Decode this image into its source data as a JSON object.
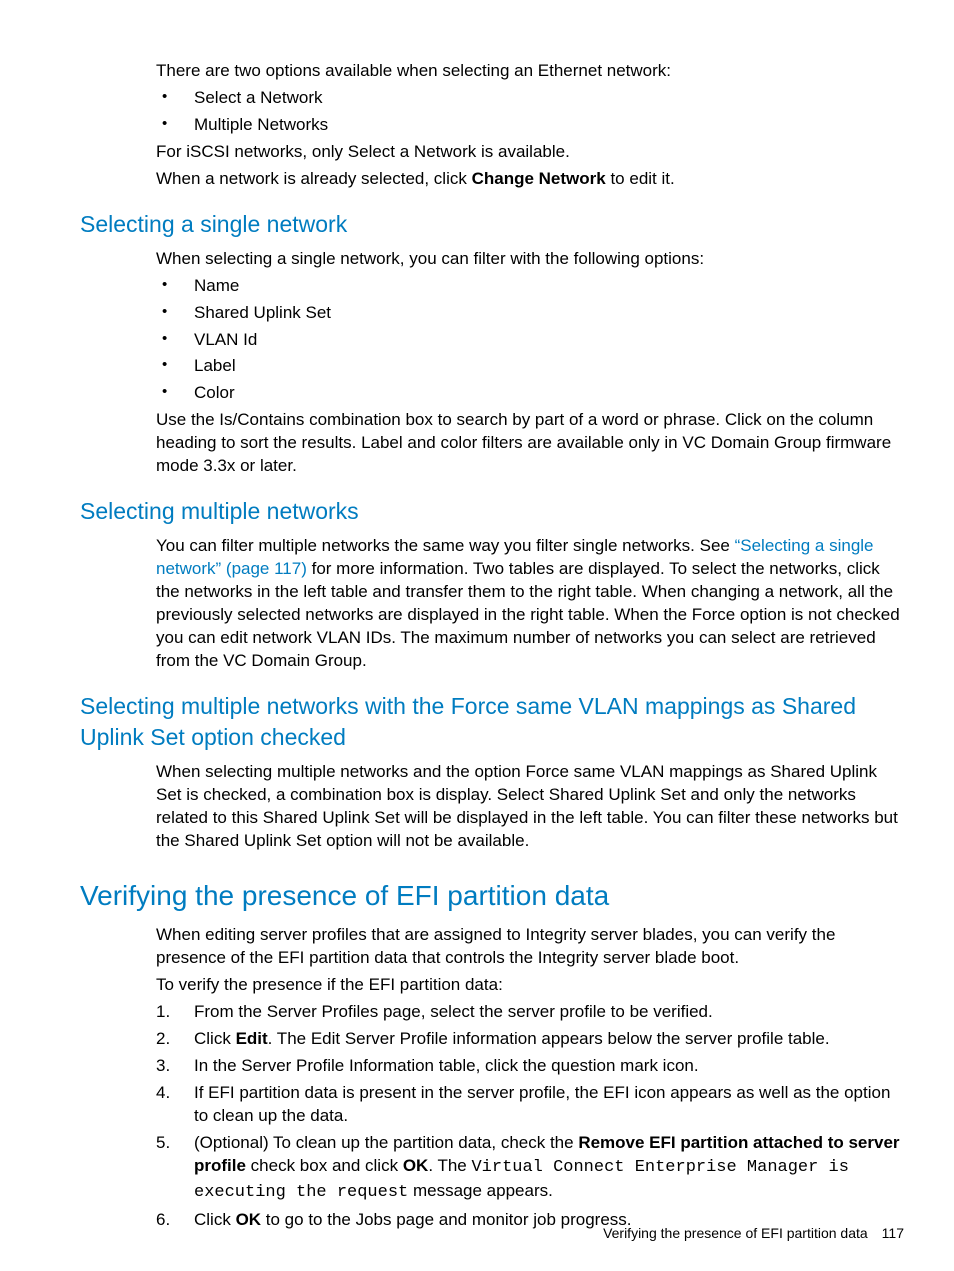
{
  "intro": {
    "line1": "There are two options available when selecting an Ethernet network:",
    "opts": [
      "Select a Network",
      "Multiple Networks"
    ],
    "line2": "For iSCSI networks, only Select a Network is available.",
    "line3_pre": "When a network is already selected, click ",
    "line3_bold": "Change Network",
    "line3_post": " to edit it."
  },
  "single": {
    "heading": "Selecting a single network",
    "intro": "When selecting a single network, you can filter with the following options:",
    "filters": [
      "Name",
      "Shared Uplink Set",
      "VLAN Id",
      "Label",
      "Color"
    ],
    "para": "Use the Is/Contains combination box to search by part of a word or phrase. Click on the column heading to sort the results.  Label and color filters are available only in VC Domain Group firmware mode 3.3x or later."
  },
  "multi": {
    "heading": "Selecting multiple networks",
    "pre": "You can filter multiple networks the same way you filter single networks. See ",
    "link": "“Selecting a single network” (page 117)",
    "post": " for more information. Two tables are displayed. To select the networks, click the networks in the left table and transfer them to the right table. When changing a network, all the previously selected networks are displayed in the right table. When the Force option is not checked you can edit network VLAN IDs. The maximum number of networks you can select are retrieved from the VC Domain Group."
  },
  "force": {
    "heading": "Selecting multiple networks with the Force same VLAN mappings as Shared Uplink Set option checked",
    "para": "When selecting multiple networks and the option Force same VLAN mappings as Shared Uplink Set is checked, a combination box is display. Select Shared Uplink Set and only the networks related to this Shared Uplink Set will be displayed in the left table. You can filter these networks but the Shared Uplink Set option will not be available."
  },
  "efi": {
    "heading": "Verifying the presence of EFI partition data",
    "p1": "When editing server profiles that are assigned to Integrity server blades, you can verify the presence of the EFI partition data that controls the Integrity server blade boot.",
    "p2": "To verify the presence if the EFI partition data:",
    "steps": {
      "s1": "From the Server Profiles page, select the server profile to be verified.",
      "s2_pre": "Click ",
      "s2_bold": "Edit",
      "s2_post": ". The Edit Server Profile information appears below the server profile table.",
      "s3": "In the Server Profile Information table, click the question mark icon.",
      "s4": "If EFI partition data is present in the server profile, the EFI icon appears as well as the option to clean up the data.",
      "s5_pre": "(Optional) To clean up the partition data, check the ",
      "s5_bold1": "Remove EFI partition attached to server profile",
      "s5_mid": " check box and click ",
      "s5_bold2": "OK",
      "s5_post1": ". The ",
      "s5_mono": "Virtual Connect Enterprise Manager is executing the request",
      "s5_post2": " message appears.",
      "s6_pre": "Click ",
      "s6_bold": "OK",
      "s6_post": " to go to the Jobs page and monitor job progress."
    }
  },
  "footer": {
    "title": "Verifying the presence of EFI partition data",
    "page": "117"
  }
}
